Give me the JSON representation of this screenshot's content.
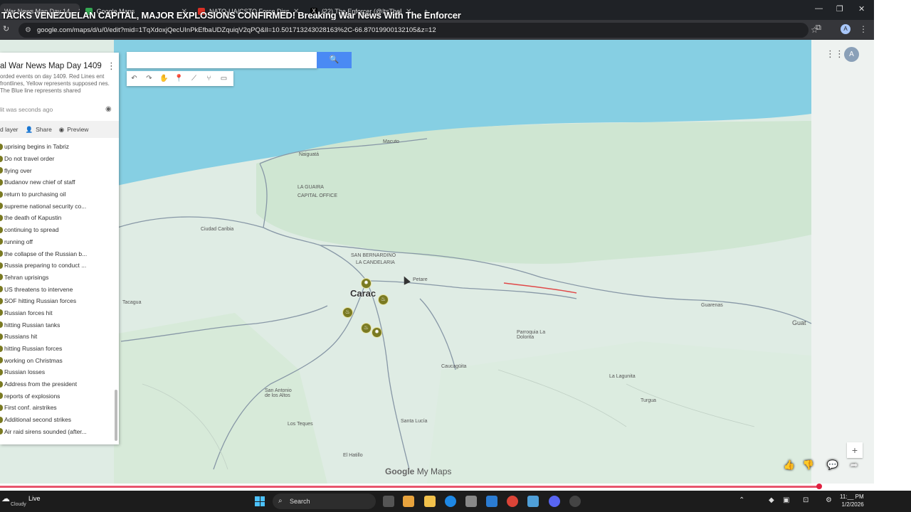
{
  "browser": {
    "tabs": [
      {
        "title": "War News Map Day 14..",
        "active": true
      },
      {
        "title": "Google Maps"
      },
      {
        "title": "NATO-UA/CSTO Force Disposit"
      },
      {
        "title": "(22) The Enforcer (@ItsTheEnf"
      }
    ],
    "new_tab": "+",
    "url": "google.com/maps/d/u/0/edit?mid=1TqXdoxjQecUInPkEfbaUDZquiqV2qPQ&ll=10.50171324302816​3%2C-66.87019900132105&z=12",
    "account_initial": "A"
  },
  "overlay_title": "TACKS VENEZUELAN CAPITAL, MAJOR EXPLOSIONS CONFIRMED! Breaking War News With The Enforcer",
  "map": {
    "search_placeholder": "",
    "search_icon": "search-icon",
    "account_initial": "A",
    "city_label": "Carac",
    "labels": [
      "Naiguatá",
      "Macuto",
      "LA GUAIRA",
      "CAPITAL OFFICE",
      "Ciudad Caribia",
      "SAN BERNARDINO",
      "LA CANDELARIA",
      "Petare",
      "Parroquia La Dolorita",
      "Guarenas",
      "Guat",
      "Los Teques",
      "San Antonio de los Altos",
      "Santa Lucía",
      "Turgua",
      "Caucagüita",
      "El Hatillo",
      "La Lagunita",
      "Tacagua"
    ],
    "attribution_google": "Google",
    "attribution_mymaps": "My Maps",
    "zoom_in": "+"
  },
  "panel": {
    "title": "al War News Map Day 1409",
    "description": "orded events on day 1409. Red Lines ent frontlines, Yellow represents supposed nes. The Blue line represents shared",
    "last_edit": "lit was seconds ago",
    "actions": {
      "add_layer": "d layer",
      "share": "Share",
      "preview": "Preview"
    },
    "items": [
      "uprising begins in Tabriz",
      "Do not travel order",
      "flying over",
      "Budanov new chief of staff",
      "return to purchasing oil",
      "supreme national security co...",
      "the death of Kapustin",
      "continuing to spread",
      "running off",
      "the collapse of the Russian b...",
      "Russia preparing to conduct ...",
      "Tehran uprisings",
      "US threatens to intervene",
      "SOF hitting Russian forces",
      "Russian forces hit",
      "hitting Russian tanks",
      "Russians hit",
      "hitting Russian forces",
      "working on Christmas",
      "Russian losses",
      "Address from the president",
      "reports of explosions",
      "First conf. airstrikes",
      "Additional second strikes",
      "Air raid sirens sounded (after..."
    ]
  },
  "taskbar": {
    "live": "Live",
    "weather": "Cloudy",
    "search": "Search",
    "time": "11:__ PM",
    "date": "1/2/2026"
  },
  "colors": {
    "accent": "#4a8af4",
    "marker": "#7a7a22",
    "progress": "#e8556d"
  }
}
